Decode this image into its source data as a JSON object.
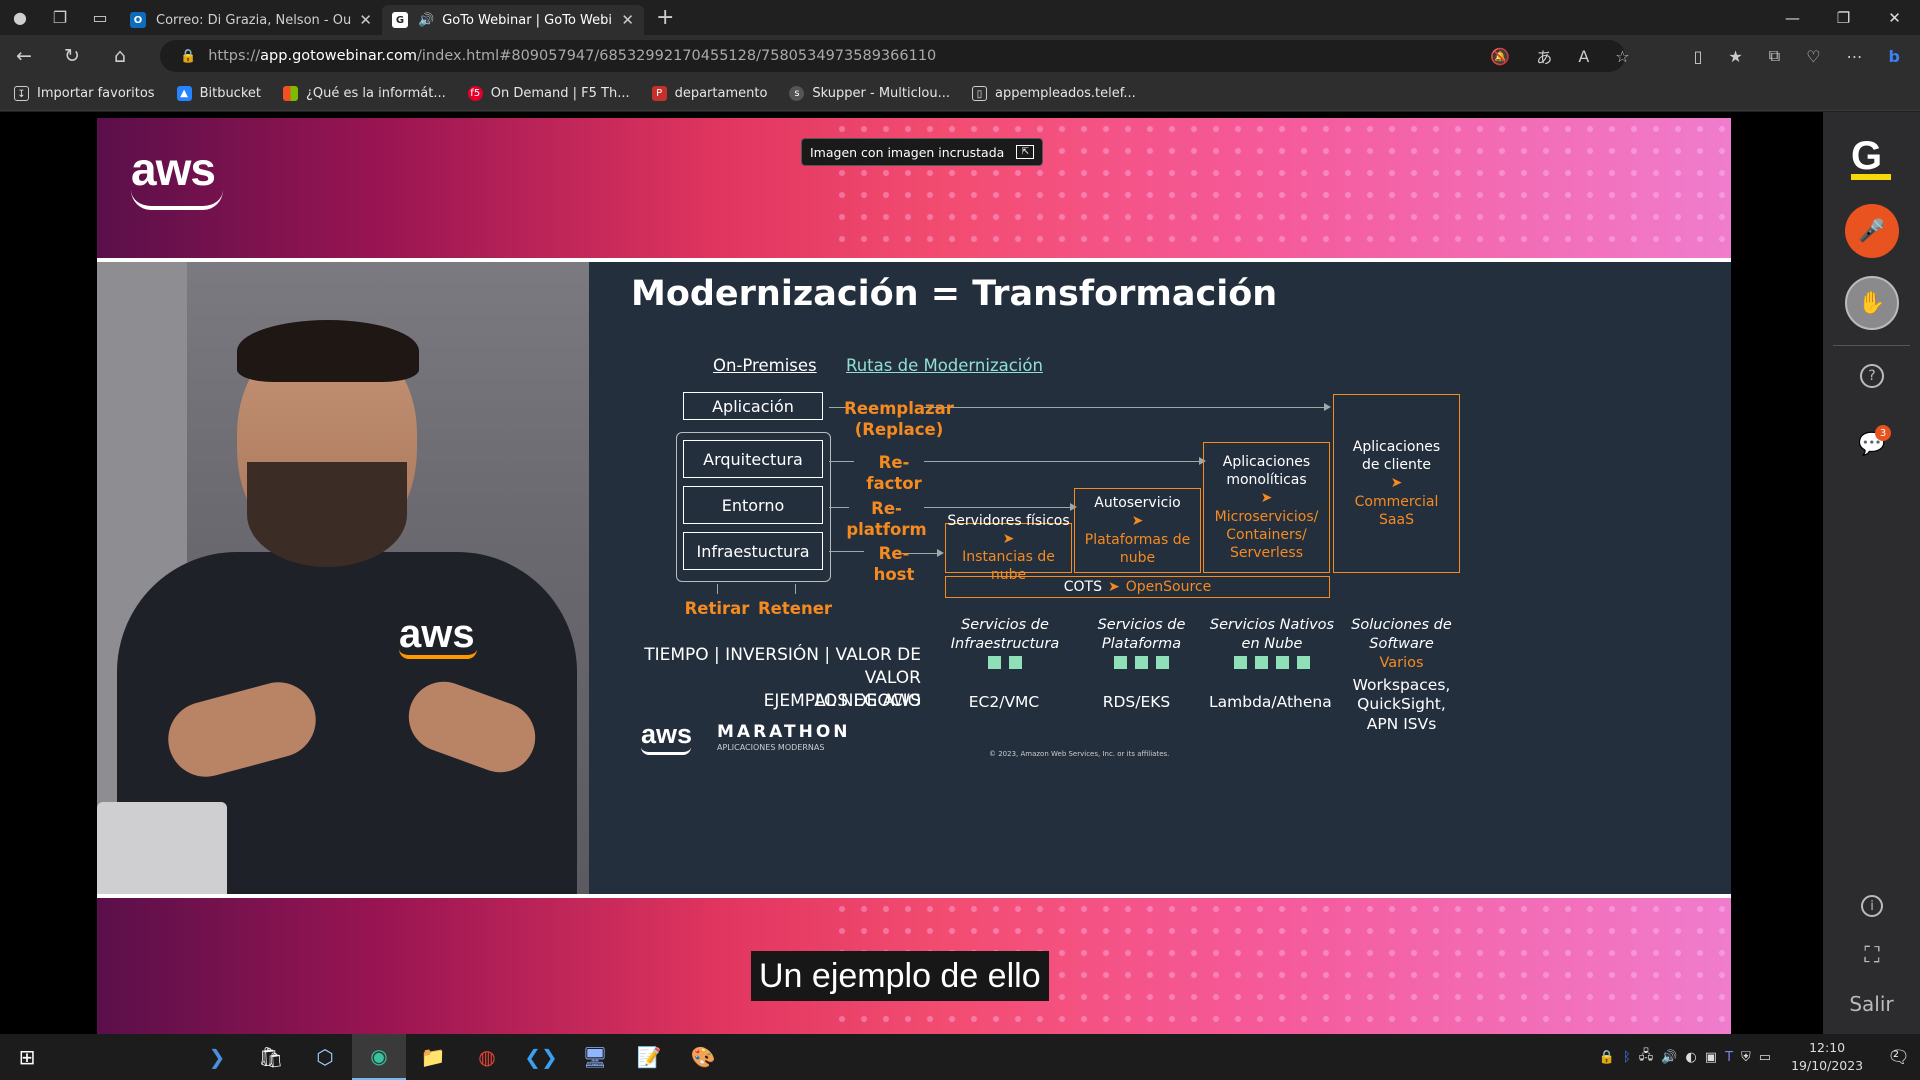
{
  "browser": {
    "tabs": [
      {
        "title": "Correo: Di Grazia, Nelson - Outlo",
        "favicon": "outlook-icon"
      },
      {
        "title": "GoTo Webinar | GoTo Webin",
        "favicon": "goto-icon"
      }
    ],
    "url": {
      "scheme": "https://",
      "host": "app.gotowebinar.com",
      "path": "/index.html#809057947/6853299217045512​8/7580534973589366110"
    },
    "bookmarks": [
      {
        "label": "Importar favoritos",
        "icon": "import-icon"
      },
      {
        "label": "Bitbucket",
        "icon": "bitbucket-icon"
      },
      {
        "label": "¿Qué es la informát...",
        "icon": "windows-icon"
      },
      {
        "label": "On Demand | F5 Th...",
        "icon": "f5-icon"
      },
      {
        "label": "departamento",
        "icon": "pdf-icon"
      },
      {
        "label": "Skupper - Multiclou...",
        "icon": "skupper-icon"
      },
      {
        "label": "appempleados.telef...",
        "icon": "page-icon"
      }
    ]
  },
  "webinar": {
    "pip_label": "Imagen con imagen incrustada",
    "aws_logo": "aws",
    "shirt_logo": "aws",
    "subtitle": "Un ejemplo de ello",
    "exit_label": "Salir",
    "chat_badge": "3",
    "colors": {
      "orange": "#f58a1f",
      "mic": "#e8531f",
      "slide_bg": "#242f3e"
    }
  },
  "slide": {
    "title": "Modernización = Transformación",
    "tab_onprem": "On-Premises",
    "tab_routes": "Rutas de Modernización",
    "app_box": "Aplicación",
    "stack": [
      "Arquitectura",
      "Entorno",
      "Infraestuctura"
    ],
    "routes": {
      "replace_1": "Reemplazar",
      "replace_2": "(Replace)",
      "refactor": "Re-factor",
      "replatform": "Re-platform",
      "rehost": "Re-host",
      "retire": "Retirar",
      "retain": "Retener"
    },
    "targets": {
      "servers": {
        "top": "Servidores físicos",
        "bottom": "Instancias de nube"
      },
      "self": {
        "top": "Autoservicio",
        "bottom": "Plataformas de nube"
      },
      "mono": {
        "top": "Aplicaciones monolíticas",
        "bottom": "Microservicios/ Containers/ Serverless"
      },
      "client": {
        "top": "Aplicaciones de cliente",
        "bottom": "Commercial SaaS"
      },
      "cots_a": "COTS",
      "cots_b": "OpenSource"
    },
    "categories": [
      {
        "name": "Servicios de Infraestructura",
        "squares": 2,
        "example": "EC2/VMC"
      },
      {
        "name": "Servicios de Plataforma",
        "squares": 3,
        "example": "RDS/EKS"
      },
      {
        "name": "Servicios Nativos en Nube",
        "squares": 4,
        "example": "Lambda/Athena"
      },
      {
        "name": "Soluciones de Software",
        "extra": "Varios",
        "example": "Workspaces, QuickSight, APN ISVs"
      }
    ],
    "side_1": "TIEMPO | INVERSIÓN | VALOR DE VALOR",
    "side_2": "AL NEGOCIO",
    "examples_label": "EJEMPLOS DE AWS",
    "marathon": "MARATHON",
    "marathon_sub": "APLICACIONES MODERNAS",
    "copyright": "© 2023, Amazon Web Services, Inc. or its affiliates."
  },
  "taskbar": {
    "time": "12:10",
    "date": "19/10/2023",
    "notif_count": "2"
  }
}
